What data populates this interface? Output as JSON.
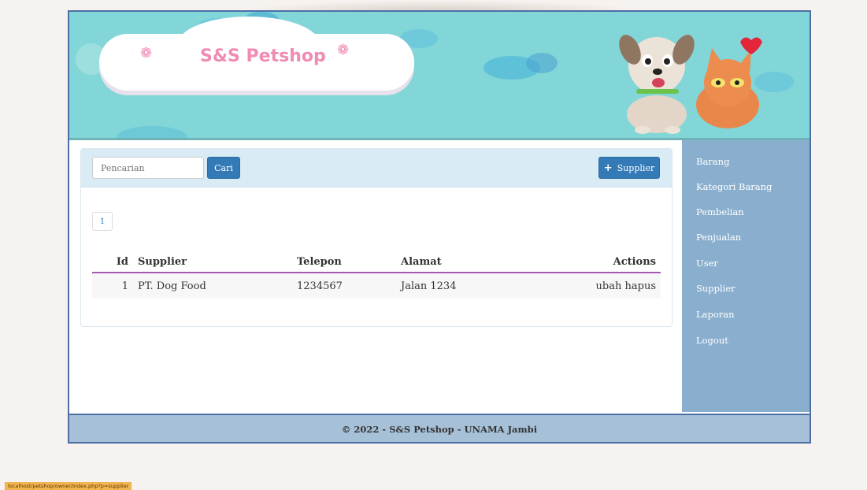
{
  "brand": {
    "name": "S&S Petshop"
  },
  "search": {
    "placeholder": "Pencarian",
    "button_label": "Cari"
  },
  "actions": {
    "add_supplier_label": "Supplier"
  },
  "pagination": {
    "current_page": "1"
  },
  "table": {
    "columns": [
      "Id",
      "Supplier",
      "Telepon",
      "Alamat",
      "Actions"
    ],
    "rows": [
      {
        "id": "1",
        "supplier": "PT. Dog Food",
        "telepon": "1234567",
        "alamat": "Jalan 1234",
        "edit": "ubah",
        "delete": "hapus"
      }
    ]
  },
  "sidebar": {
    "items": [
      {
        "label": "Barang"
      },
      {
        "label": "Kategori Barang"
      },
      {
        "label": "Pembelian"
      },
      {
        "label": "Penjualan"
      },
      {
        "label": "User"
      },
      {
        "label": "Supplier"
      },
      {
        "label": "Laporan"
      },
      {
        "label": "Logout"
      }
    ]
  },
  "footer": {
    "text": "© 2022 - S&S Petshop - UNAMA Jambi"
  },
  "status_bar": {
    "url": "localhost/petshop/owner/index.php?p=supplier"
  },
  "colors": {
    "banner": "#82d6d8",
    "accent_button": "#337ab7",
    "sidebar": "#8aafce",
    "footer": "#a6c0d8",
    "table_header_rule": "#a45ab5",
    "brand_pink": "#f08bb3"
  },
  "icons": {
    "add": "plus-icon",
    "paw": "paw-icon"
  }
}
